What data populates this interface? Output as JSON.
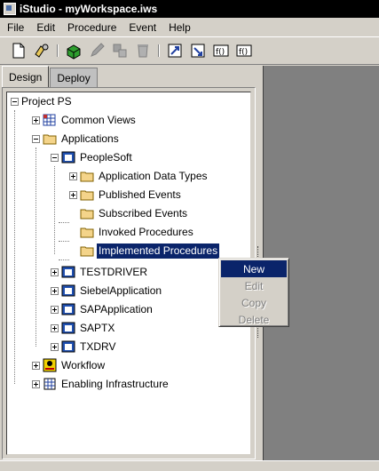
{
  "window": {
    "title": "iStudio - myWorkspace.iws"
  },
  "menu": [
    "File",
    "Edit",
    "Procedure",
    "Event",
    "Help"
  ],
  "toolbar": {
    "buttons": [
      "new-file-icon",
      "open-icon",
      "add-icon",
      "edit-icon",
      "copy-icon",
      "delete-icon",
      "deploy-icon",
      "deploy-all-icon",
      "function-icon",
      "function-alt-icon"
    ]
  },
  "tabs": [
    {
      "label": "Design",
      "active": true
    },
    {
      "label": "Deploy",
      "active": false
    }
  ],
  "tree": {
    "root": "Project PS",
    "common_views": "Common Views",
    "applications": "Applications",
    "peoplesoft": "PeopleSoft",
    "app_data_types": "Application Data Types",
    "published_events": "Published Events",
    "subscribed_events": "Subscribed Events",
    "invoked_procedures": "Invoked Procedures",
    "implemented_procedures": "Implemented Procedures",
    "testdriver": "TESTDRIVER",
    "siebel": "SiebelApplication",
    "sap": "SAPApplication",
    "saptx": "SAPTX",
    "txdrv": "TXDRV",
    "workflow": "Workflow",
    "enabling_infrastructure": "Enabling Infrastructure"
  },
  "context_menu": {
    "items": [
      {
        "label": "New",
        "enabled": true,
        "highlighted": true
      },
      {
        "label": "Edit",
        "enabled": false
      },
      {
        "label": "Copy",
        "enabled": false
      },
      {
        "label": "Delete",
        "enabled": false
      }
    ]
  },
  "colors": {
    "selection": "#0a246a",
    "face": "#d4d0c8",
    "dark": "#808080"
  }
}
